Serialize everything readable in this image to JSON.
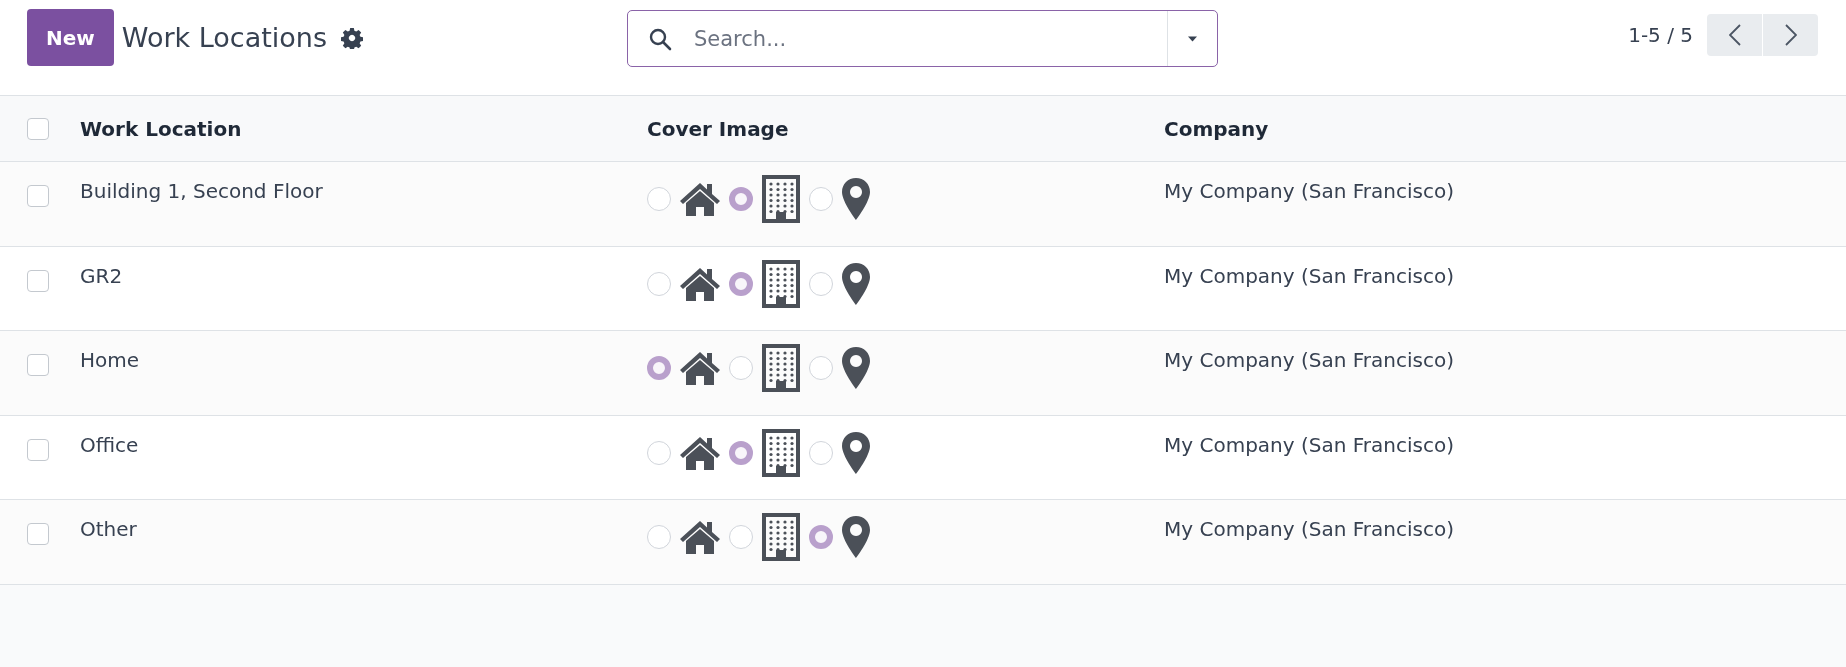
{
  "control_panel": {
    "new_button": "New",
    "title": "Work Locations",
    "search": {
      "placeholder": "Search..."
    },
    "pager": "1-5 / 5"
  },
  "table": {
    "all_checked": false,
    "columns": [
      "Work Location",
      "Cover Image",
      "Company"
    ],
    "rows": [
      {
        "checked": false,
        "name": "Building 1, Second Floor",
        "company": "My Company (San Francisco)",
        "cover_options": [
          {
            "kind": "home",
            "selected": false
          },
          {
            "kind": "office",
            "selected": true
          },
          {
            "kind": "other",
            "selected": false
          }
        ]
      },
      {
        "checked": false,
        "name": "GR2",
        "company": "My Company (San Francisco)",
        "cover_options": [
          {
            "kind": "home",
            "selected": false
          },
          {
            "kind": "office",
            "selected": true
          },
          {
            "kind": "other",
            "selected": false
          }
        ]
      },
      {
        "checked": false,
        "name": "Home",
        "company": "My Company (San Francisco)",
        "cover_options": [
          {
            "kind": "home",
            "selected": true
          },
          {
            "kind": "office",
            "selected": false
          },
          {
            "kind": "other",
            "selected": false
          }
        ]
      },
      {
        "checked": false,
        "name": "Office",
        "company": "My Company (San Francisco)",
        "cover_options": [
          {
            "kind": "home",
            "selected": false
          },
          {
            "kind": "office",
            "selected": true
          },
          {
            "kind": "other",
            "selected": false
          }
        ]
      },
      {
        "checked": false,
        "name": "Other",
        "company": "My Company (San Francisco)",
        "cover_options": [
          {
            "kind": "home",
            "selected": false
          },
          {
            "kind": "office",
            "selected": false
          },
          {
            "kind": "other",
            "selected": true
          }
        ]
      }
    ]
  }
}
